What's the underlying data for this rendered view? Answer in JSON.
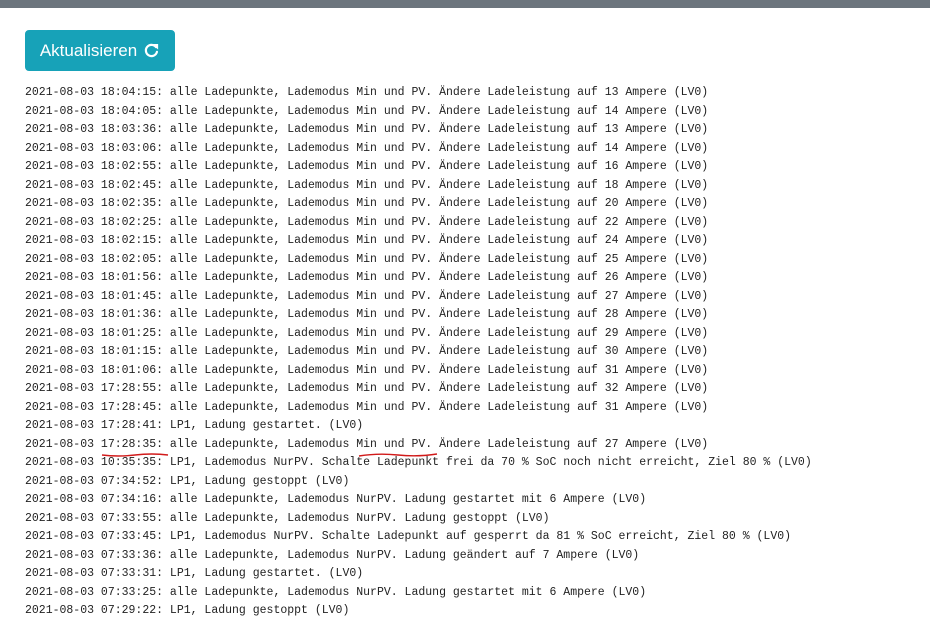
{
  "toolbar": {
    "refresh_label": "Aktualisieren",
    "refresh_icon": "refresh-icon",
    "button_color": "#17a2b8"
  },
  "annotation": {
    "color": "#d11a1a",
    "underlined_line_index": 20
  },
  "log": [
    "2021-08-03 18:04:15: alle Ladepunkte, Lademodus Min und PV. Ändere Ladeleistung auf 13 Ampere (LV0)",
    "2021-08-03 18:04:05: alle Ladepunkte, Lademodus Min und PV. Ändere Ladeleistung auf 14 Ampere (LV0)",
    "2021-08-03 18:03:36: alle Ladepunkte, Lademodus Min und PV. Ändere Ladeleistung auf 13 Ampere (LV0)",
    "2021-08-03 18:03:06: alle Ladepunkte, Lademodus Min und PV. Ändere Ladeleistung auf 14 Ampere (LV0)",
    "2021-08-03 18:02:55: alle Ladepunkte, Lademodus Min und PV. Ändere Ladeleistung auf 16 Ampere (LV0)",
    "2021-08-03 18:02:45: alle Ladepunkte, Lademodus Min und PV. Ändere Ladeleistung auf 18 Ampere (LV0)",
    "2021-08-03 18:02:35: alle Ladepunkte, Lademodus Min und PV. Ändere Ladeleistung auf 20 Ampere (LV0)",
    "2021-08-03 18:02:25: alle Ladepunkte, Lademodus Min und PV. Ändere Ladeleistung auf 22 Ampere (LV0)",
    "2021-08-03 18:02:15: alle Ladepunkte, Lademodus Min und PV. Ändere Ladeleistung auf 24 Ampere (LV0)",
    "2021-08-03 18:02:05: alle Ladepunkte, Lademodus Min und PV. Ändere Ladeleistung auf 25 Ampere (LV0)",
    "2021-08-03 18:01:56: alle Ladepunkte, Lademodus Min und PV. Ändere Ladeleistung auf 26 Ampere (LV0)",
    "2021-08-03 18:01:45: alle Ladepunkte, Lademodus Min und PV. Ändere Ladeleistung auf 27 Ampere (LV0)",
    "2021-08-03 18:01:36: alle Ladepunkte, Lademodus Min und PV. Ändere Ladeleistung auf 28 Ampere (LV0)",
    "2021-08-03 18:01:25: alle Ladepunkte, Lademodus Min und PV. Ändere Ladeleistung auf 29 Ampere (LV0)",
    "2021-08-03 18:01:15: alle Ladepunkte, Lademodus Min und PV. Ändere Ladeleistung auf 30 Ampere (LV0)",
    "2021-08-03 18:01:06: alle Ladepunkte, Lademodus Min und PV. Ändere Ladeleistung auf 31 Ampere (LV0)",
    "2021-08-03 17:28:55: alle Ladepunkte, Lademodus Min und PV. Ändere Ladeleistung auf 32 Ampere (LV0)",
    "2021-08-03 17:28:45: alle Ladepunkte, Lademodus Min und PV. Ändere Ladeleistung auf 31 Ampere (LV0)",
    "2021-08-03 17:28:41: LP1, Ladung gestartet. (LV0)",
    "2021-08-03 17:28:35: alle Ladepunkte, Lademodus Min und PV. Ändere Ladeleistung auf 27 Ampere (LV0)",
    "2021-08-03 10:35:35: LP1, Lademodus NurPV. Schalte Ladepunkt frei da 70 % SoC noch nicht erreicht, Ziel 80 % (LV0)",
    "2021-08-03 07:34:52: LP1, Ladung gestoppt (LV0)",
    "2021-08-03 07:34:16: alle Ladepunkte, Lademodus NurPV. Ladung gestartet mit 6 Ampere (LV0)",
    "2021-08-03 07:33:55: alle Ladepunkte, Lademodus NurPV. Ladung gestoppt (LV0)",
    "2021-08-03 07:33:45: LP1, Lademodus NurPV. Schalte Ladepunkt auf gesperrt da 81 % SoC erreicht, Ziel 80 % (LV0)",
    "2021-08-03 07:33:36: alle Ladepunkte, Lademodus NurPV. Ladung geändert auf 7 Ampere (LV0)",
    "2021-08-03 07:33:31: LP1, Ladung gestartet. (LV0)",
    "2021-08-03 07:33:25: alle Ladepunkte, Lademodus NurPV. Ladung gestartet mit 6 Ampere (LV0)",
    "2021-08-03 07:29:22: LP1, Ladung gestoppt (LV0)"
  ]
}
